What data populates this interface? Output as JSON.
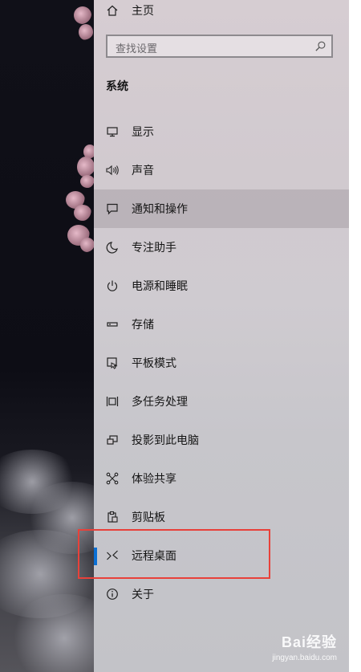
{
  "home": {
    "label": "主页",
    "icon": "home-icon"
  },
  "search": {
    "placeholder": "查找设置",
    "icon": "search-icon"
  },
  "section": {
    "title": "系统"
  },
  "nav_items": [
    {
      "label": "显示",
      "icon": "monitor-icon"
    },
    {
      "label": "声音",
      "icon": "speaker-icon"
    },
    {
      "label": "通知和操作",
      "icon": "notification-icon",
      "state": "hover"
    },
    {
      "label": "专注助手",
      "icon": "moon-icon"
    },
    {
      "label": "电源和睡眠",
      "icon": "power-icon"
    },
    {
      "label": "存储",
      "icon": "storage-icon"
    },
    {
      "label": "平板模式",
      "icon": "tablet-mode-icon"
    },
    {
      "label": "多任务处理",
      "icon": "multitasking-icon"
    },
    {
      "label": "投影到此电脑",
      "icon": "project-icon"
    },
    {
      "label": "体验共享",
      "icon": "share-icon"
    },
    {
      "label": "剪贴板",
      "icon": "clipboard-icon"
    },
    {
      "label": "远程桌面",
      "icon": "remote-desktop-icon",
      "state": "selected"
    },
    {
      "label": "关于",
      "icon": "info-icon"
    }
  ],
  "colors": {
    "accent": "#0a6fd4",
    "annotation": "#e8413a"
  },
  "watermark": {
    "brand": "Bai经验",
    "url": "jingyan.baidu.com"
  }
}
